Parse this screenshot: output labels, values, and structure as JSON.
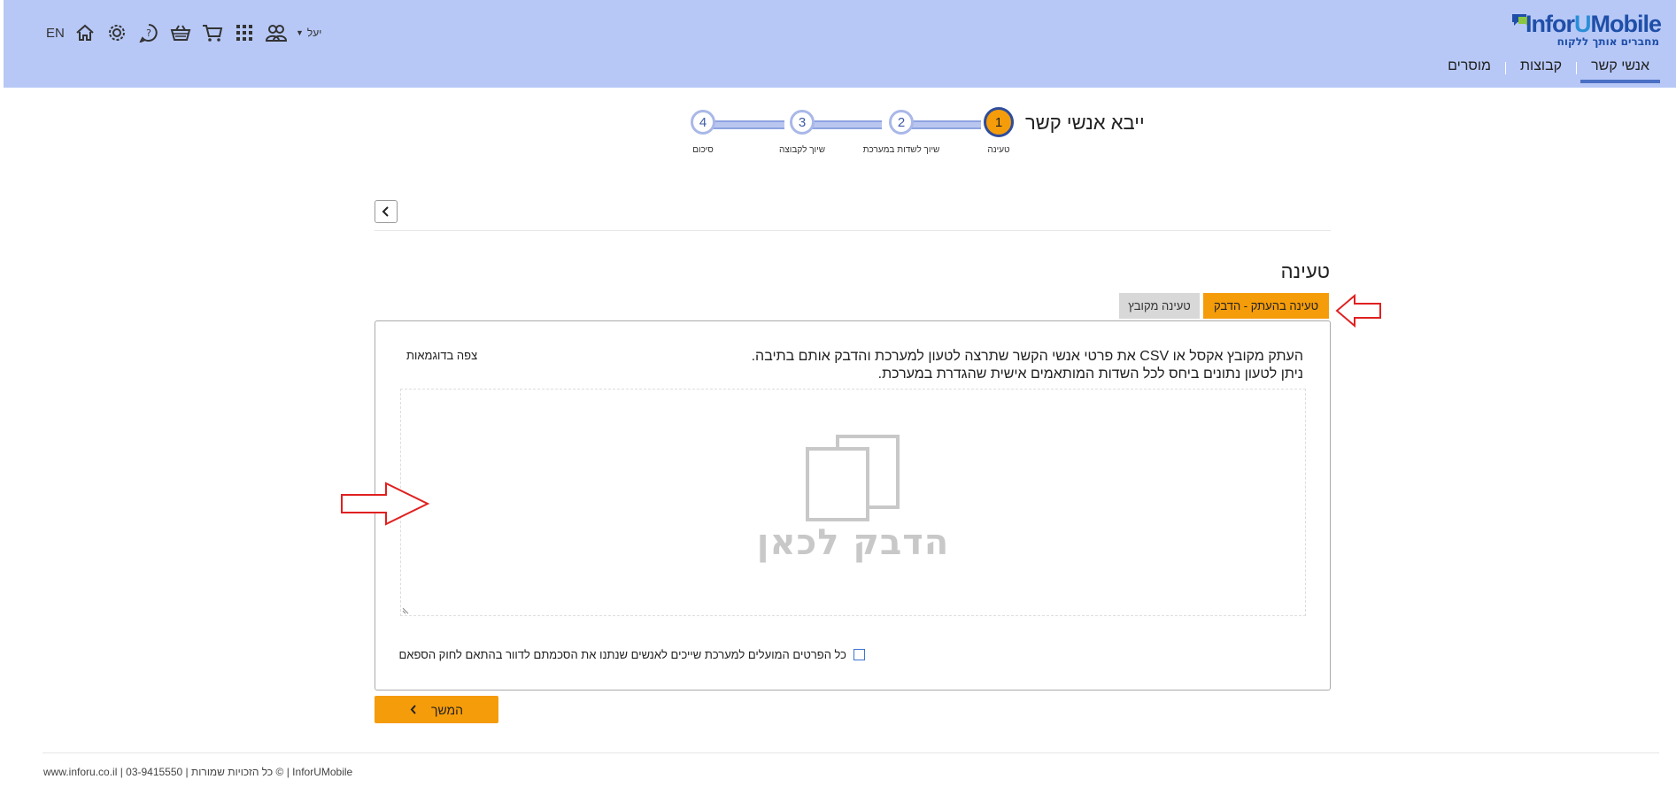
{
  "header": {
    "logo": {
      "brand_main": "Infor",
      "brand_accent": "U",
      "brand_end": "Mobile",
      "tagline": "מחברים אותך ללקוח"
    },
    "nav": [
      {
        "label": "אנשי קשר",
        "active": true
      },
      {
        "label": "קבוצות",
        "active": false
      },
      {
        "label": "מוסרים",
        "active": false
      }
    ],
    "toolbar": {
      "language": "EN",
      "user_name": "יעל",
      "icons": [
        "home-icon",
        "gear-icon",
        "help-icon",
        "basket-icon",
        "cart-icon",
        "apps-grid-icon",
        "users-icon"
      ]
    }
  },
  "wizard": {
    "title": "ייבא אנשי קשר",
    "steps": [
      {
        "number": "1",
        "label": "טעינה",
        "active": true
      },
      {
        "number": "2",
        "label": "שיוך לשדות במערכת",
        "active": false
      },
      {
        "number": "3",
        "label": "שיוך לקבוצה",
        "active": false
      },
      {
        "number": "4",
        "label": "סיכום",
        "active": false
      }
    ]
  },
  "main": {
    "section_title": "טעינה",
    "tabs": [
      {
        "label": "טעינה בהעתק - הדבק",
        "active": true
      },
      {
        "label": "טעינה מקובץ",
        "active": false
      }
    ],
    "instructions_line1": "העתק מקובץ אקסל או CSV את פרטי אנשי הקשר שתרצה לטעון למערכת והדבק אותם בתיבה.",
    "instructions_line2": "ניתן לטעון נתונים ביחס לכל השדות המותאמים אישית שהגדרת במערכת.",
    "examples_link": "צפה בדוגמאות",
    "paste_placeholder": "הדבק לכאן",
    "consent_text": "כל הפרטים המועלים למערכת שייכים לאנשים שנתנו את הסכמתם לדוור בהתאם לחוק הספאם",
    "consent_checked": false,
    "continue_label": "המשך"
  },
  "footer": {
    "text": "www.inforu.co.il | 03-9415550 | כל הזכויות שמורות © | InforUMobile"
  },
  "colors": {
    "header_bg": "#b7c8f7",
    "accent_orange": "#f59c0a",
    "nav_active_underline": "#4a6fc4",
    "annotation_red": "#e02020"
  }
}
